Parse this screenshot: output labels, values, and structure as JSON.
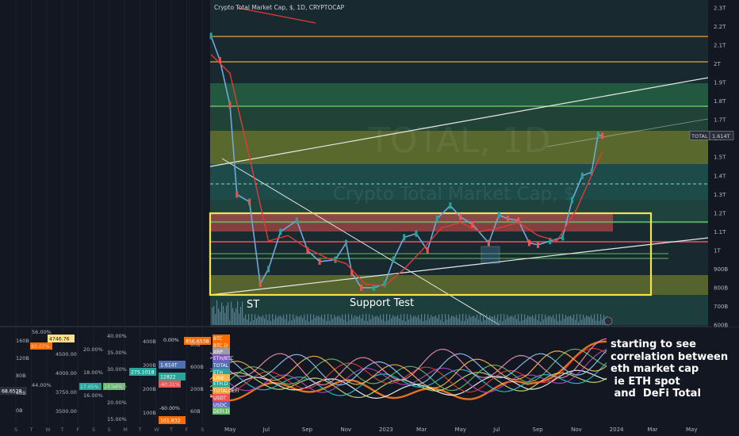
{
  "header": {
    "title": "Crypto Total Market Cap, $, 1D, CRYPTOCAP"
  },
  "watermark": {
    "symbol": "TOTAL, 1D",
    "name": "Crypto Total Market Cap, $"
  },
  "price_tag": {
    "symbol": "TOTAL",
    "value": "1.614T"
  },
  "annotations": {
    "st": "ST",
    "support_test": "Support Test",
    "note_lines": [
      "starting to see",
      "correlation between",
      "eth market cap",
      " ie ETH spot",
      " and  DeFi Total"
    ]
  },
  "colors": {
    "background": "#131722",
    "price_axis_bg": "#131722",
    "text": "#b2b5be",
    "white_note": "#ffffff",
    "yellow_box": "#f2e24b",
    "red_zone": "#e0504d",
    "green_line": "#4caf50",
    "orange_line": "#e8a03a",
    "ma_red": "#e53935",
    "candle_up": "#26a69a",
    "candle_down": "#ef5350",
    "volume": "#5b8fd6"
  },
  "chart_data": [
    {
      "type": "line",
      "title": "Crypto Total Market Cap, $, 1D, CRYPTOCAP",
      "y_unit": "USD",
      "ylim": [
        600000000000,
        2300000000000
      ],
      "y_tick_labels": [
        "2.3T",
        "2.2T",
        "2.1T",
        "2T",
        "1.9T",
        "1.8T",
        "1.7T",
        "1.6T",
        "1.5T",
        "1.4T",
        "1.3T",
        "1.2T",
        "1.1T",
        "1T",
        "900B",
        "800B",
        "700B",
        "600B"
      ],
      "y_tick_values": [
        2300,
        2200,
        2100,
        2000,
        1900,
        1800,
        1700,
        1600,
        1500,
        1400,
        1300,
        1200,
        1100,
        1000,
        900,
        800,
        700,
        600
      ],
      "x_tick_labels": [
        "May",
        "Jul",
        "Sep",
        "Nov",
        "2023",
        "Mar",
        "May",
        "Jul",
        "Sep",
        "Nov",
        "2024",
        "Mar",
        "May"
      ],
      "x_tick_dates": [
        "2022-05-01",
        "2022-07-01",
        "2022-09-01",
        "2022-11-01",
        "2023-01-01",
        "2023-03-01",
        "2023-05-01",
        "2023-07-01",
        "2023-09-01",
        "2023-11-01",
        "2024-01-01",
        "2024-03-01",
        "2024-05-01"
      ],
      "series": [
        {
          "x": [
            "2022-04-01",
            "2022-04-15",
            "2022-05-01",
            "2022-05-12",
            "2022-06-01",
            "2022-06-18",
            "2022-07-01",
            "2022-07-20",
            "2022-08-15",
            "2022-09-01",
            "2022-09-20",
            "2022-10-15",
            "2022-11-01",
            "2022-11-10",
            "2022-11-25",
            "2022-12-15",
            "2023-01-01",
            "2023-01-15",
            "2023-02-01",
            "2023-02-20",
            "2023-03-10",
            "2023-03-25",
            "2023-04-15",
            "2023-05-01",
            "2023-05-20",
            "2023-06-15",
            "2023-07-01",
            "2023-07-15",
            "2023-08-01",
            "2023-08-18",
            "2023-09-01",
            "2023-09-20",
            "2023-10-10",
            "2023-10-25",
            "2023-11-10",
            "2023-11-25",
            "2023-12-05",
            "2023-12-12"
          ],
          "values": [
            2150,
            2020,
            1780,
            1300,
            1260,
            820,
            900,
            1100,
            1160,
            1000,
            940,
            950,
            1040,
            880,
            800,
            800,
            820,
            950,
            1070,
            1090,
            1000,
            1170,
            1240,
            1180,
            1140,
            1040,
            1190,
            1170,
            1160,
            1040,
            1030,
            1050,
            1070,
            1270,
            1400,
            1420,
            1620,
            1614
          ]
        },
        {
          "x": [
            "2022-04-01",
            "2022-05-01",
            "2022-06-01",
            "2022-07-01",
            "2022-08-01",
            "2022-09-01",
            "2022-10-01",
            "2022-11-01",
            "2022-12-01",
            "2023-01-01",
            "2023-02-01",
            "2023-03-01",
            "2023-04-01",
            "2023-05-01",
            "2023-06-01",
            "2023-07-01",
            "2023-08-01",
            "2023-09-01",
            "2023-10-01",
            "2023-11-01",
            "2023-12-01",
            "2023-12-12"
          ],
          "values": [
            2050,
            1950,
            1500,
            1050,
            1080,
            1010,
            960,
            930,
            820,
            810,
            900,
            1000,
            1120,
            1150,
            1100,
            1120,
            1150,
            1080,
            1050,
            1220,
            1450,
            1530
          ]
        }
      ]
    },
    {
      "type": "line",
      "x_tick_labels": [
        "May",
        "Jul",
        "Sep",
        "Nov",
        "2023",
        "Mar",
        "May",
        "Jul",
        "Sep",
        "Nov",
        "2024",
        "Mar",
        "May"
      ],
      "x_tick_dates": [
        "2022-05-01",
        "2022-07-01",
        "2022-09-01",
        "2022-11-01",
        "2023-01-01",
        "2023-03-01",
        "2023-05-01",
        "2023-07-01",
        "2023-09-01",
        "2023-11-01",
        "2024-01-01",
        "2024-03-01",
        "2024-05-01"
      ],
      "series_tags": [
        "BTC",
        "BTC.D",
        "TOTAL",
        "ETH",
        "ETH.D",
        "TOTALDEFI",
        "USDT",
        "USDC",
        "LINK",
        "XRP",
        "ETH/BTC",
        "DEFI.D"
      ],
      "tag_values": [
        "856.6538",
        "1.614T",
        "275.1018",
        "101.832",
        "4746.76",
        "68.6528",
        "12822"
      ],
      "percent_labels": [
        "0.00%",
        "-40.31%",
        "-60.00%",
        "83.07%",
        "17.05%",
        "24.96%"
      ],
      "left_axis_labels": [
        "160B",
        "120B",
        "80B",
        "40B",
        "0B"
      ],
      "axis2_labels": [
        "56.00%",
        "44.00%",
        "40.00%"
      ],
      "axis3_labels": [
        "4500.00",
        "4000.00",
        "3750.00",
        "3500.00"
      ],
      "axis4_labels": [
        "20.00%",
        "18.00%",
        "16.00%"
      ],
      "axis5_labels": [
        "40.00%",
        "35.00%",
        "30.00%",
        "25.00%",
        "20.00%",
        "15.00%"
      ],
      "axis6_labels": [
        "400B",
        "300B",
        "200B",
        "100B"
      ],
      "axis7_labels": [
        "80B",
        "600B",
        "200B",
        "60B"
      ],
      "bottom_letters": [
        "S",
        "T",
        "W",
        "T",
        "F",
        "S",
        "S",
        "M",
        "T",
        "W",
        "T",
        "F",
        "S"
      ]
    }
  ]
}
